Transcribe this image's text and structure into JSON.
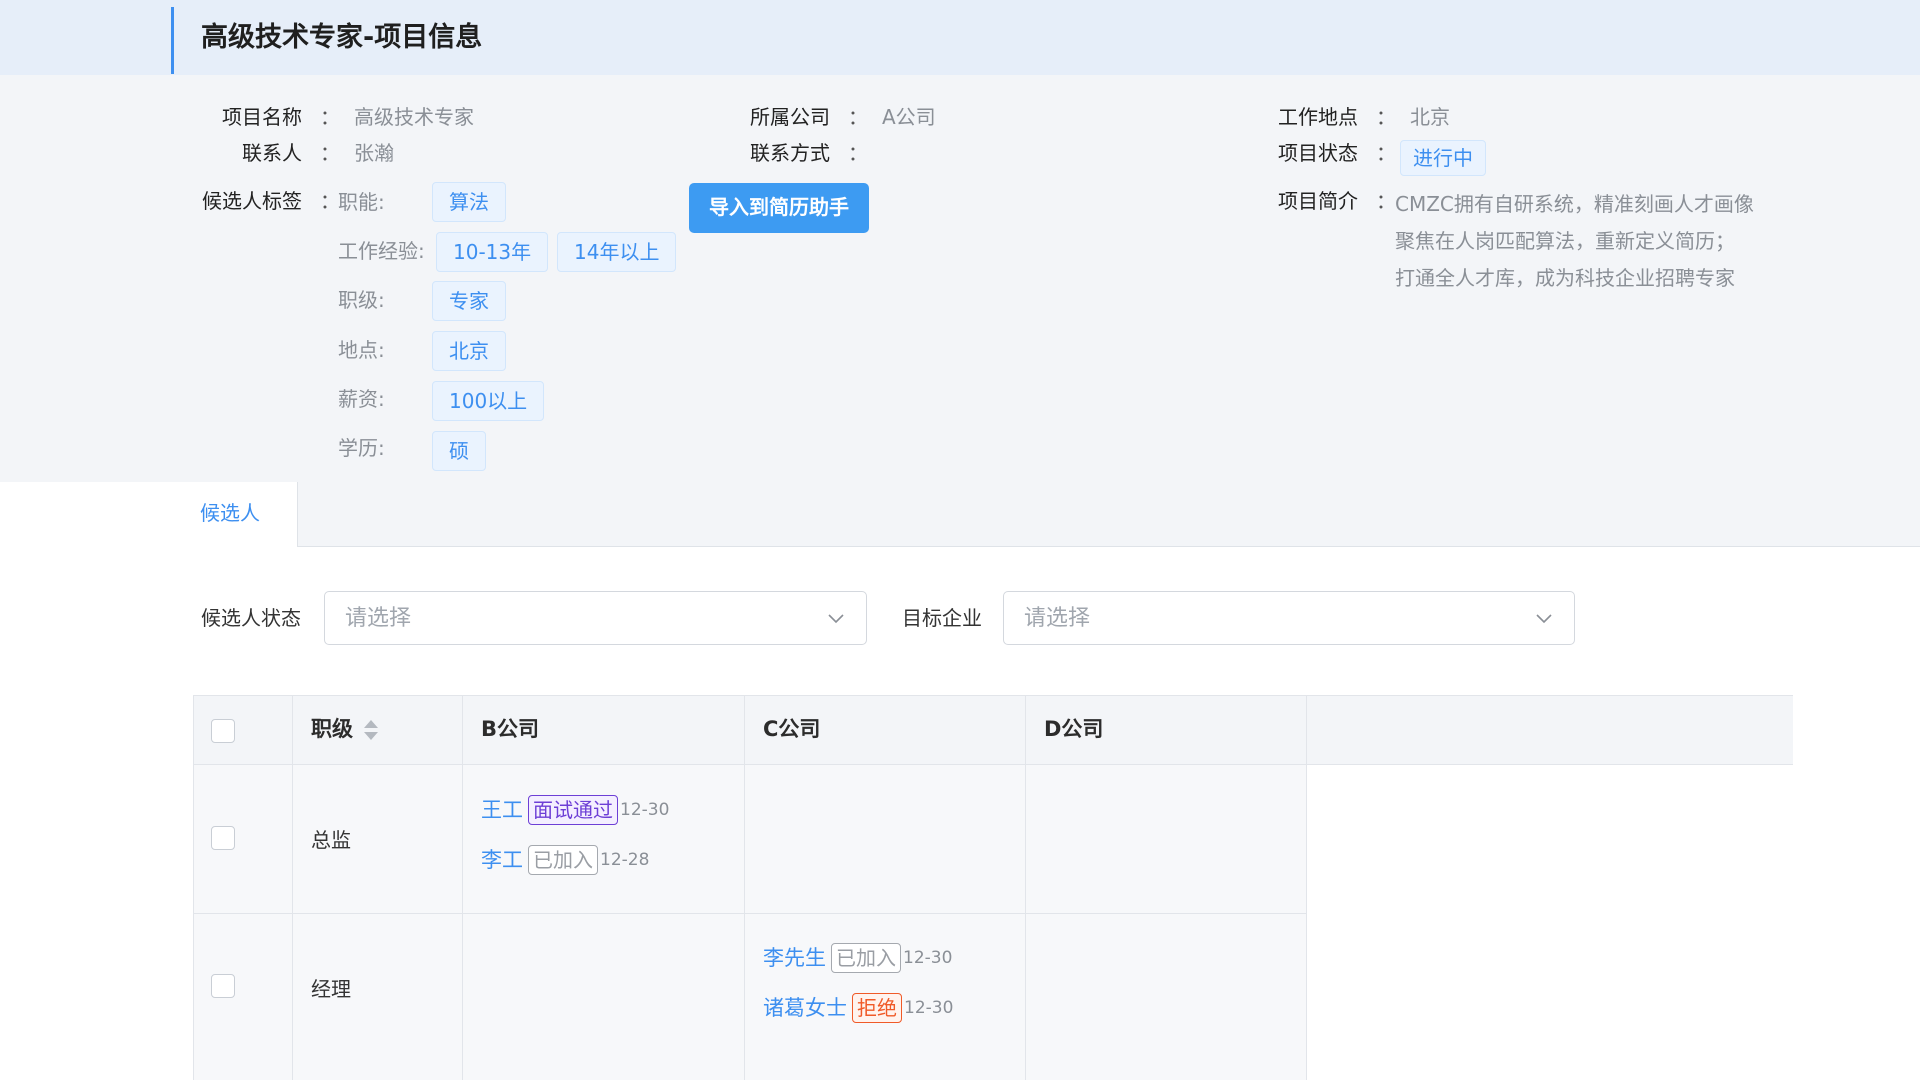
{
  "header": {
    "title": "高级技术专家-项目信息"
  },
  "info": {
    "project_name": {
      "label": "项目名称",
      "colon": "：",
      "value": "高级技术专家"
    },
    "company": {
      "label": "所属公司",
      "colon": "：",
      "value": "A公司"
    },
    "location": {
      "label": "工作地点",
      "colon": "：",
      "value": "北京"
    },
    "contact": {
      "label": "联系人",
      "colon": "：",
      "value": "张瀚"
    },
    "contact_method": {
      "label": "联系方式",
      "colon": "：",
      "value": ""
    },
    "status": {
      "label": "项目状态",
      "colon": "：",
      "value": "进行中"
    },
    "candidate_tags": {
      "label": "候选人标签",
      "colon": "：",
      "function": {
        "label": "职能:",
        "tags": [
          "算法"
        ]
      },
      "experience": {
        "label": "工作经验:",
        "tags": [
          "10-13年",
          "14年以上"
        ]
      },
      "level": {
        "label": "职级:",
        "tags": [
          "专家"
        ]
      },
      "place": {
        "label": "地点:",
        "tags": [
          "北京"
        ]
      },
      "salary": {
        "label": "薪资:",
        "tags": [
          "100以上"
        ]
      },
      "education": {
        "label": "学历:",
        "tags": [
          "硕"
        ]
      }
    },
    "import_button": "导入到简历助手",
    "intro": {
      "label": "项目简介",
      "colon": "：",
      "lines": [
        "CMZC拥有自研系统，精准刻画人才画像",
        "聚焦在人岗匹配算法，重新定义简历；",
        "打通全人才库，成为科技企业招聘专家"
      ]
    }
  },
  "tabs": [
    {
      "label": "候选人",
      "active": true
    }
  ],
  "filters": {
    "status": {
      "label": "候选人状态",
      "placeholder": "请选择"
    },
    "target": {
      "label": "目标企业",
      "placeholder": "请选择"
    }
  },
  "table": {
    "columns": [
      "职级",
      "B公司",
      "C公司",
      "D公司"
    ],
    "rows": [
      {
        "level": "总监",
        "B": [
          {
            "name": "王工",
            "status": "面试通过",
            "date": "12-30"
          },
          {
            "name": "李工",
            "status": "已加入",
            "date": "12-28"
          }
        ],
        "C": [],
        "D": []
      },
      {
        "level": "经理",
        "B": [],
        "C": [
          {
            "name": "李先生",
            "status": "已加入",
            "date": "12-30"
          },
          {
            "name": "诸葛女士",
            "status": "拒绝",
            "date": "12-30"
          }
        ],
        "D": []
      }
    ]
  },
  "colors": {
    "accent": "#3d8ff0",
    "button": "#3d9bf2",
    "passed": "#6d3fd6",
    "rejected": "#f05a28",
    "header_bg": "#e6eef9"
  }
}
